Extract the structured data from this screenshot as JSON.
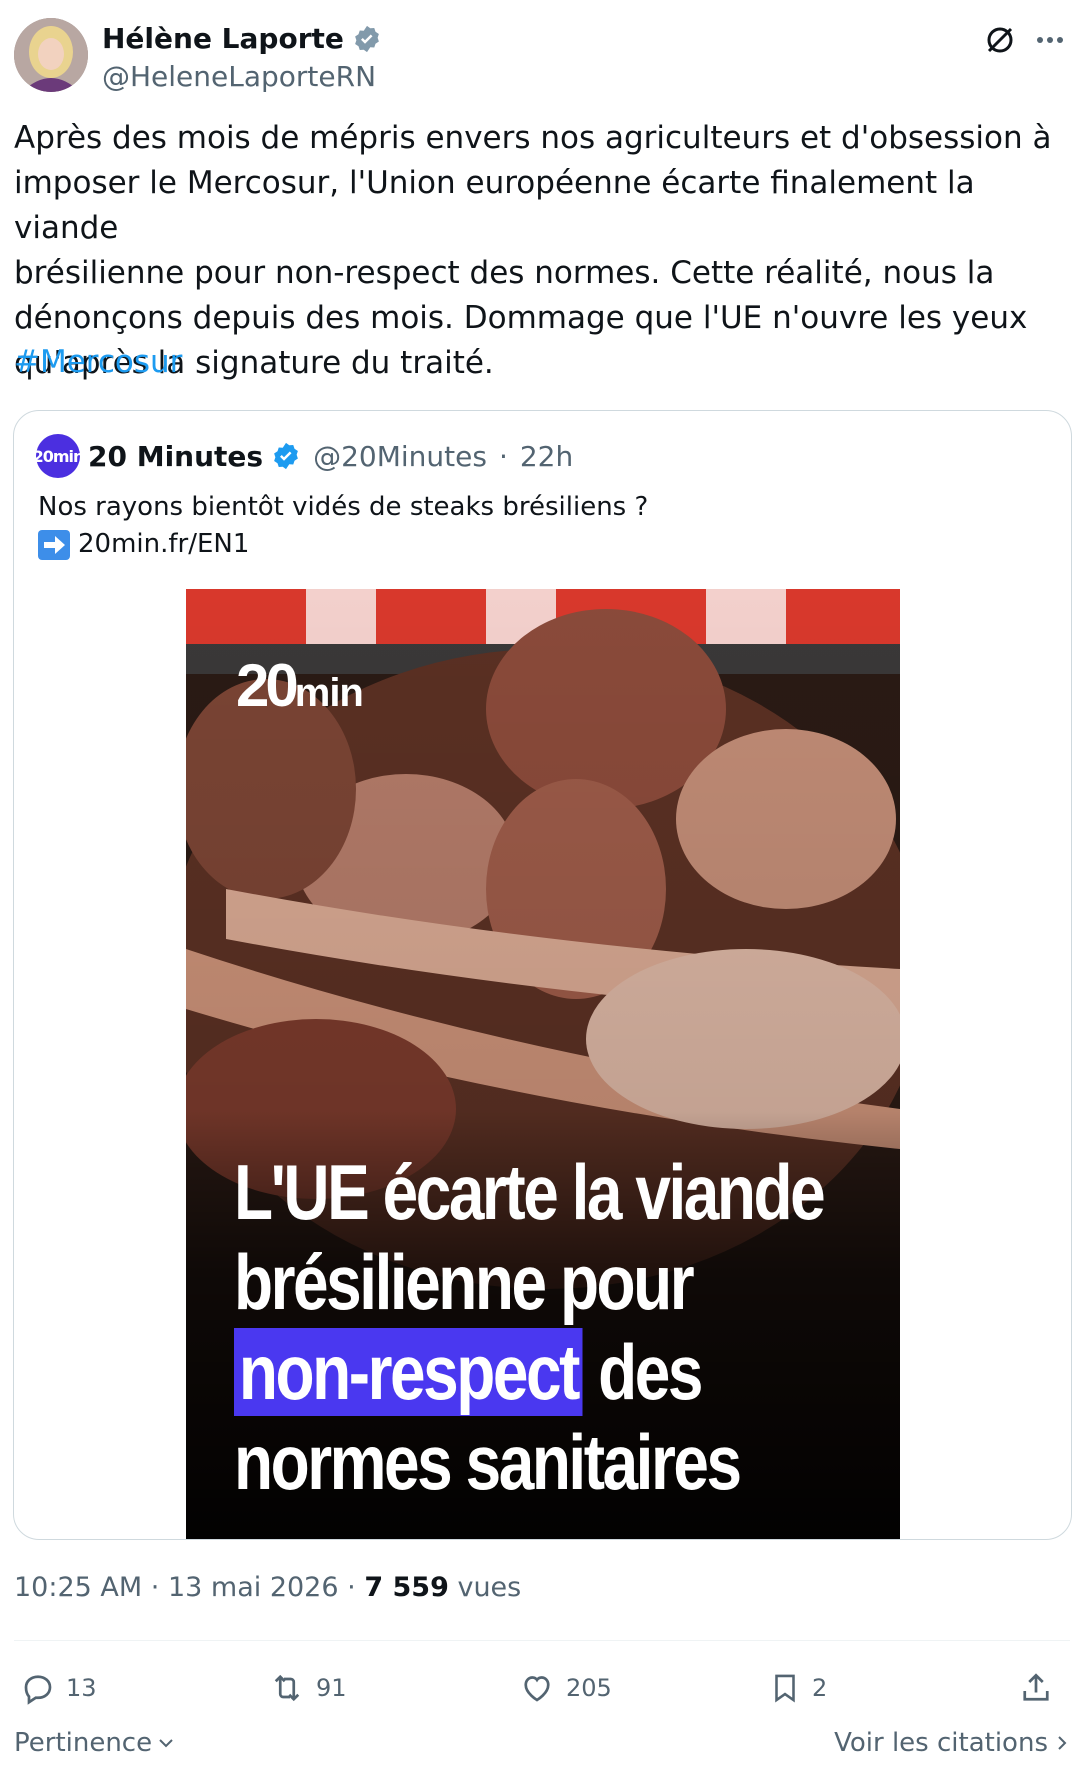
{
  "author": {
    "name": "Hélène Laporte",
    "handle": "@HeleneLaporteRN"
  },
  "tweet": {
    "text": "Après des mois de mépris envers nos agriculteurs et d'obsession à\nimposer le Mercosur, l'Union européenne écarte finalement la viande\nbrésilienne pour non-respect des normes. Cette réalité, nous la\ndénonçons depuis des mois. Dommage que l'UE n'ouvre les yeux\nqu'après la signature du traité.",
    "hashtag": "#Mercosur"
  },
  "quote": {
    "name": "20 Minutes",
    "handle": "@20Minutes",
    "separator": "·",
    "time": "22h",
    "text": "Nos rayons bientôt vidés de steaks brésiliens ?",
    "link": "20min.fr/EN1",
    "avatar_text": "20min",
    "media": {
      "brand_main": "20",
      "brand_small": "min",
      "headline_line1": "L'UE écarte la viande",
      "headline_line2": "brésilienne pour",
      "headline_highlight": "non-respect",
      "headline_line3_rest": "des",
      "headline_line4": "normes sanitaires"
    }
  },
  "meta": {
    "time": "10:25 AM",
    "separator": "·",
    "date": "13 mai 2026",
    "separator2": "·",
    "views_count": "7 559",
    "views_label": "vues"
  },
  "actions": {
    "replies": "13",
    "reposts": "91",
    "likes": "205",
    "bookmarks": "2"
  },
  "footer": {
    "sort_label": "Pertinence",
    "quotes_label": "Voir les citations"
  },
  "colors": {
    "accent": "#1d9bf0",
    "verified": "#1d9bf0",
    "verified_gray": "#829aab",
    "highlight": "#4a38f0",
    "secondary_text": "#536471"
  }
}
